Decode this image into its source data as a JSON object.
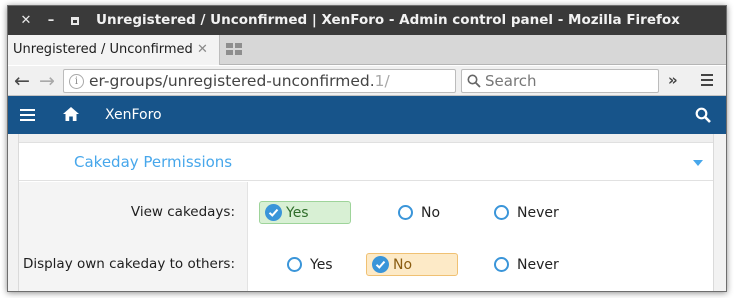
{
  "window": {
    "title": "Unregistered / Unconfirmed | XenForo - Admin control panel - Mozilla Firefox",
    "controls": {
      "close": "✕",
      "minimize": "–"
    }
  },
  "tabs": [
    {
      "title": "Unregistered / Unconfirmed",
      "close": "✕",
      "active": true
    }
  ],
  "navbar": {
    "url_prefix": "er-groups/unregistered-unconfirmed.",
    "url_tail": "1/",
    "search_placeholder": "Search",
    "overflow": "»"
  },
  "app_header": {
    "brand": "XenForo",
    "icons": [
      "menu-icon",
      "home-icon",
      "search-icon"
    ],
    "background_color": "#17548a"
  },
  "section": {
    "title": "Cakeday Permissions",
    "accent_color": "#47a7eb"
  },
  "permission_rows": [
    {
      "label": "View cakedays:",
      "options": [
        "Yes",
        "No",
        "Never"
      ],
      "selected": "Yes"
    },
    {
      "label": "Display own cakeday to others:",
      "options": [
        "Yes",
        "No",
        "Never"
      ],
      "selected": "No"
    }
  ],
  "colors": {
    "selected_yes_bg": "#d8f0d4",
    "selected_no_bg": "#fdeac7",
    "radio": "#3a95d9"
  }
}
